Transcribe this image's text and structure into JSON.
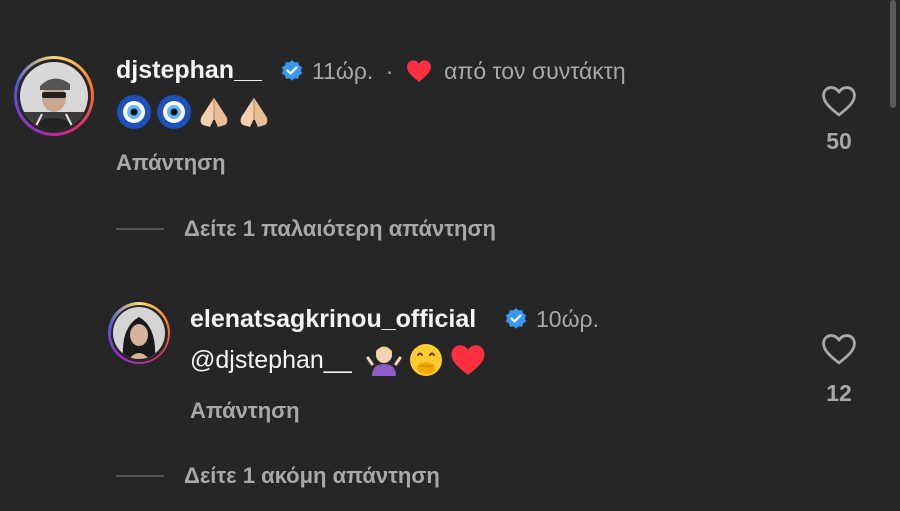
{
  "comments": [
    {
      "username": "djstephan__",
      "time": "11ώρ.",
      "separator": "·",
      "liked_by_author_text": "από τον συντάκτη",
      "text_emojis": [
        "nazar-amulet",
        "nazar-amulet",
        "folded-hands",
        "folded-hands"
      ],
      "reply_label": "Απάντηση",
      "likes": "50"
    },
    {
      "username": "elenatsagkrinou_official",
      "time": "10ώρ.",
      "mention": "@djstephan__",
      "text_emojis": [
        "person-shrugging",
        "face-with-hand-over-mouth",
        "red-heart"
      ],
      "reply_label": "Απάντηση",
      "likes": "12"
    }
  ],
  "view_older_replies": "Δείτε 1 παλαιότερη απάντηση",
  "view_more_replies": "Δείτε 1 ακόμη απάντηση",
  "colors": {
    "background": "#262626",
    "text_primary": "#f5f5f5",
    "text_secondary": "#a8a8a8",
    "verified_blue": "#3897f0",
    "heart_red": "#ff3040"
  }
}
